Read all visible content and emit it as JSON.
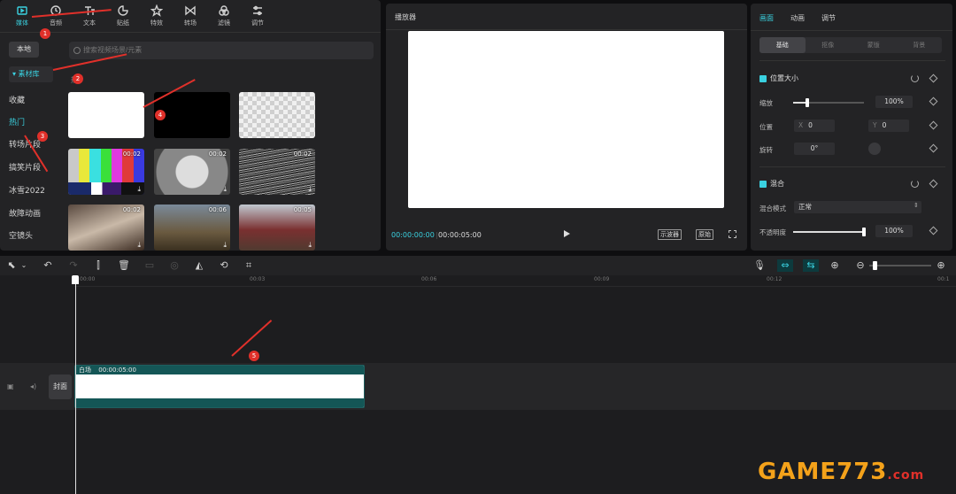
{
  "media_toolbar": {
    "tools": [
      {
        "label": "媒体",
        "icon": "media-icon",
        "active": true
      },
      {
        "label": "音频",
        "icon": "audio-icon"
      },
      {
        "label": "文本",
        "icon": "text-icon"
      },
      {
        "label": "贴纸",
        "icon": "sticker-icon"
      },
      {
        "label": "特效",
        "icon": "effects-icon"
      },
      {
        "label": "转场",
        "icon": "transition-icon"
      },
      {
        "label": "滤镜",
        "icon": "filter-icon"
      },
      {
        "label": "调节",
        "icon": "adjust-icon"
      }
    ]
  },
  "sidebar": {
    "local": "本地",
    "library": "▾ 素材库",
    "items": [
      "收藏",
      "热门",
      "转场片段",
      "搞笑片段",
      "冰雪2022",
      "故障动画",
      "空镜头"
    ]
  },
  "search": {
    "placeholder": "搜索视频场景/元素"
  },
  "section_label": "热",
  "thumbnails": [
    {
      "kind": "white"
    },
    {
      "kind": "black"
    },
    {
      "kind": "transparent"
    },
    {
      "kind": "color-bars",
      "duration": "00:02"
    },
    {
      "kind": "test-card",
      "duration": "00:02"
    },
    {
      "kind": "noise",
      "duration": "00:02"
    },
    {
      "kind": "photo",
      "duration": "00:02"
    },
    {
      "kind": "photo",
      "duration": "00:06"
    },
    {
      "kind": "photo",
      "duration": "00:05"
    }
  ],
  "player": {
    "title": "播放器",
    "current_time": "00:00:00:00",
    "total_time": "00:00:05:00",
    "waveform_btn": "示波器",
    "original_btn": "原始"
  },
  "inspector": {
    "tabs": [
      "画面",
      "动画",
      "调节"
    ],
    "subtabs": [
      "基础",
      "抠像",
      "蒙版",
      "背景"
    ],
    "position_size": {
      "title": "位置大小",
      "scale_label": "缩放",
      "scale_value": "100%",
      "scale_fraction": 0.2,
      "position_label": "位置",
      "x_label": "X",
      "x_value": "0",
      "y_label": "Y",
      "y_value": "0",
      "rotate_label": "旋转",
      "rotate_value": "0°"
    },
    "blend": {
      "title": "混合",
      "mode_label": "混合模式",
      "mode_value": "正常",
      "opacity_label": "不透明度",
      "opacity_value": "100%",
      "opacity_fraction": 1.0
    }
  },
  "timeline": {
    "ruler": [
      "00:00",
      "00:03",
      "00:06",
      "00:09",
      "00:12",
      "00:1"
    ],
    "cover_label": "封面",
    "clip": {
      "name": "白场",
      "duration": "00:00:05:00"
    }
  },
  "annotations": [
    "1",
    "2",
    "3",
    "4",
    "5"
  ],
  "watermark": {
    "main": "GAME773",
    "suffix": ".com"
  },
  "colors": {
    "accent": "#3ad1e0",
    "annotation": "#e0302a",
    "clip": "#145656"
  }
}
